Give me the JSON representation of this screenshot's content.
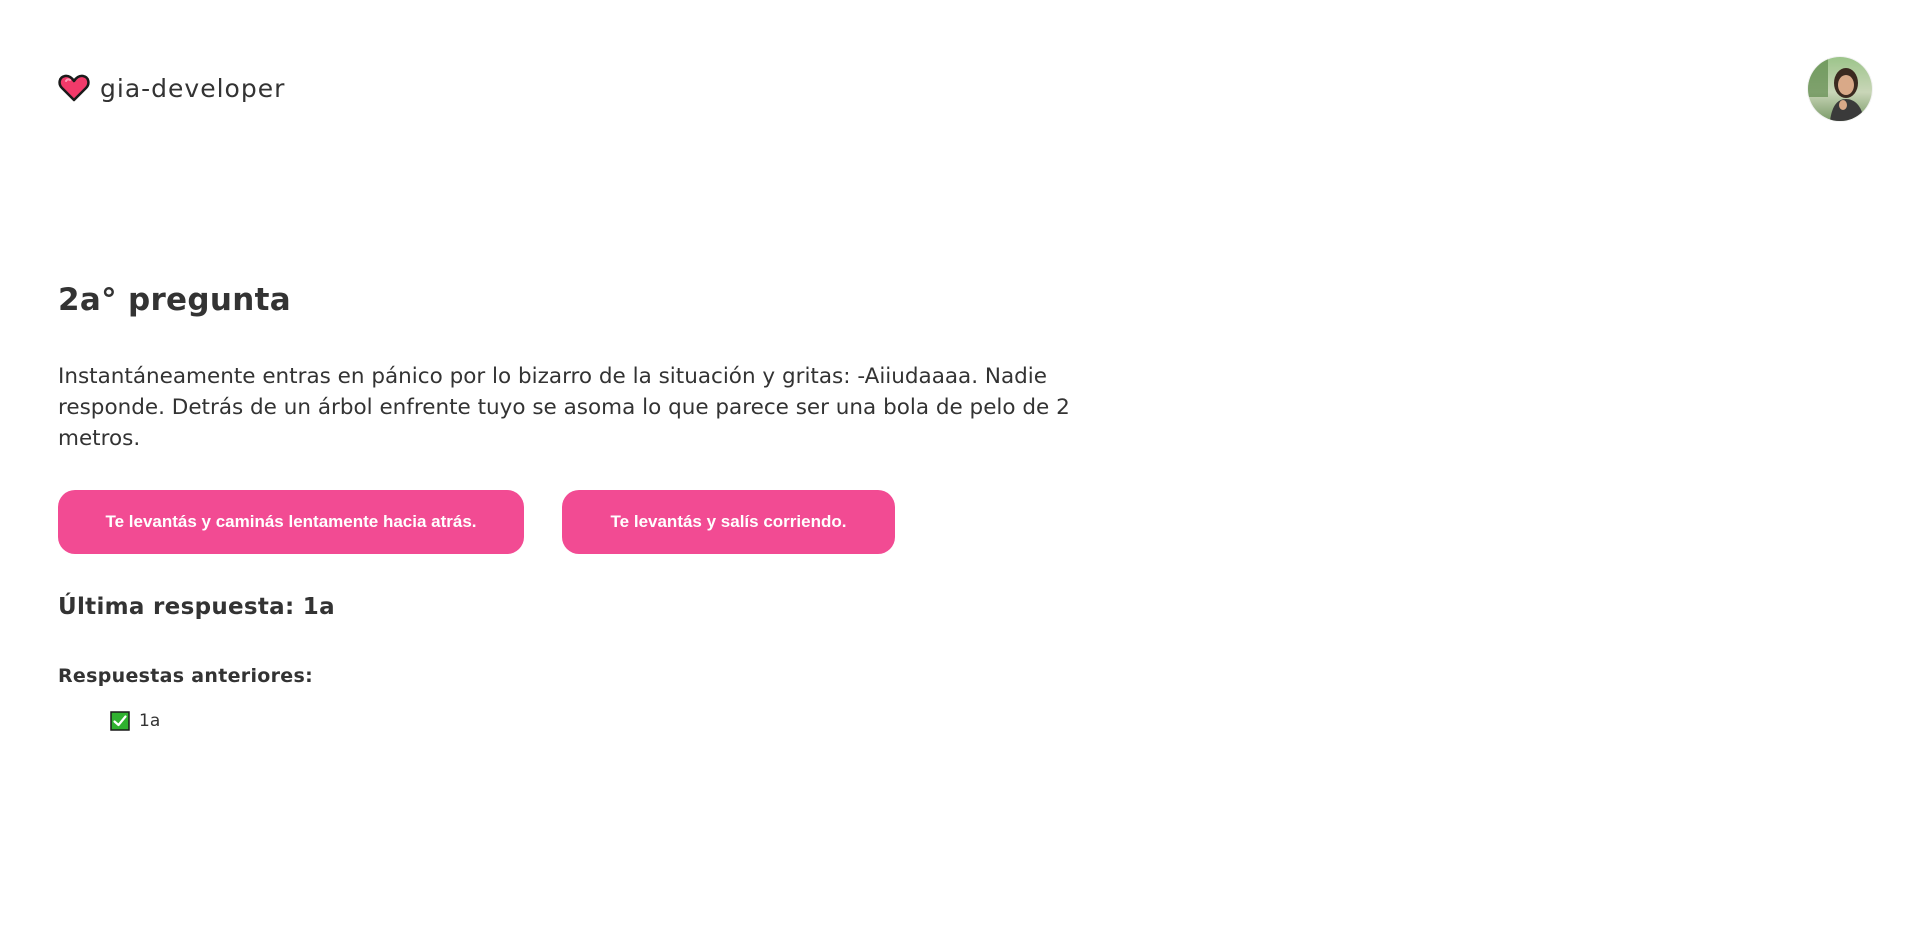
{
  "header": {
    "brand_name": "gia-developer",
    "brand_icon": "heart-icon",
    "avatar_icon": "user-avatar"
  },
  "question": {
    "title": "2a° pregunta",
    "text": "Instantáneamente entras en pánico por lo bizarro de la situación y gritas: -Aiiudaaaa. Nadie responde. Detrás de un árbol enfrente tuyo se asoma lo que parece ser una bola de pelo de 2 metros.",
    "options": [
      {
        "label": "Te levantás y caminás lentamente hacia atrás."
      },
      {
        "label": "Te levantás y salís corriendo."
      }
    ]
  },
  "last_answer": {
    "text": "Última respuesta: 1a"
  },
  "previous_answers": {
    "heading": "Respuestas anteriores:",
    "items": [
      {
        "label": "1a",
        "icon": "check-box-icon"
      }
    ]
  },
  "colors": {
    "accent": "#f24b93",
    "text": "#333333",
    "check_green": "#2fb12f"
  }
}
